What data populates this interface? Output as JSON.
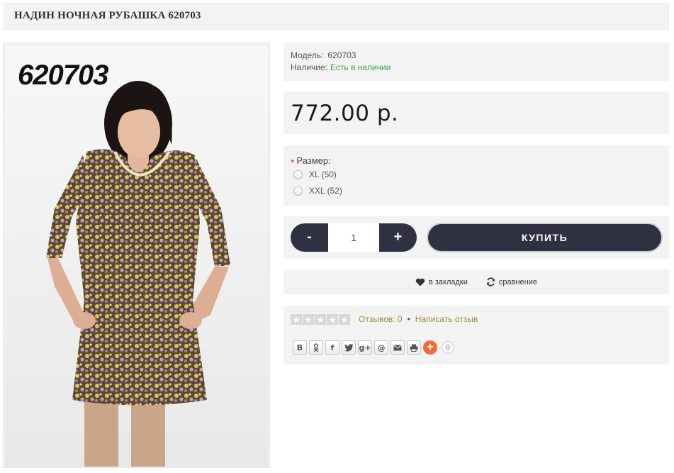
{
  "product": {
    "title": "НАДИН НОЧНАЯ РУБАШКА 620703",
    "image_code": "620703",
    "model_label": "Модель:",
    "model_value": "620703",
    "stock_label": "Наличие:",
    "stock_value": "Есть в наличии",
    "price": "772.00 р."
  },
  "options": {
    "size_label": "Размер:",
    "required_mark": "*",
    "sizes": [
      {
        "label": "XL (50)"
      },
      {
        "label": "XXL (52)"
      }
    ]
  },
  "cart": {
    "minus_label": "-",
    "plus_label": "+",
    "quantity": "1",
    "buy_label": "КУПИТЬ"
  },
  "actions": {
    "wishlist_label": "в закладки",
    "compare_label": "сравнение"
  },
  "reviews": {
    "rating": 0,
    "max_rating": 5,
    "count_text": "Отзывов: 0",
    "separator": "•",
    "write_label": "Написать отзыв"
  },
  "share": {
    "buttons": [
      {
        "icon": "vk-icon",
        "glyph": "В"
      },
      {
        "icon": "odnoklassniki-icon",
        "glyph": "ok"
      },
      {
        "icon": "facebook-icon",
        "glyph": "f"
      },
      {
        "icon": "twitter-icon",
        "glyph": "t"
      },
      {
        "icon": "google-plus-icon",
        "glyph": "g+"
      },
      {
        "icon": "mail-ru-icon",
        "glyph": "@"
      },
      {
        "icon": "email-icon",
        "glyph": "✉"
      },
      {
        "icon": "print-icon",
        "glyph": "⎙"
      }
    ],
    "more_glyph": "+",
    "counter": "0"
  },
  "colors": {
    "accent": "#2f3142",
    "in_stock": "#3aa54a",
    "review_link": "#a08a4e",
    "share_more": "#f26b3a",
    "panel_bg": "#f3f3f3"
  }
}
